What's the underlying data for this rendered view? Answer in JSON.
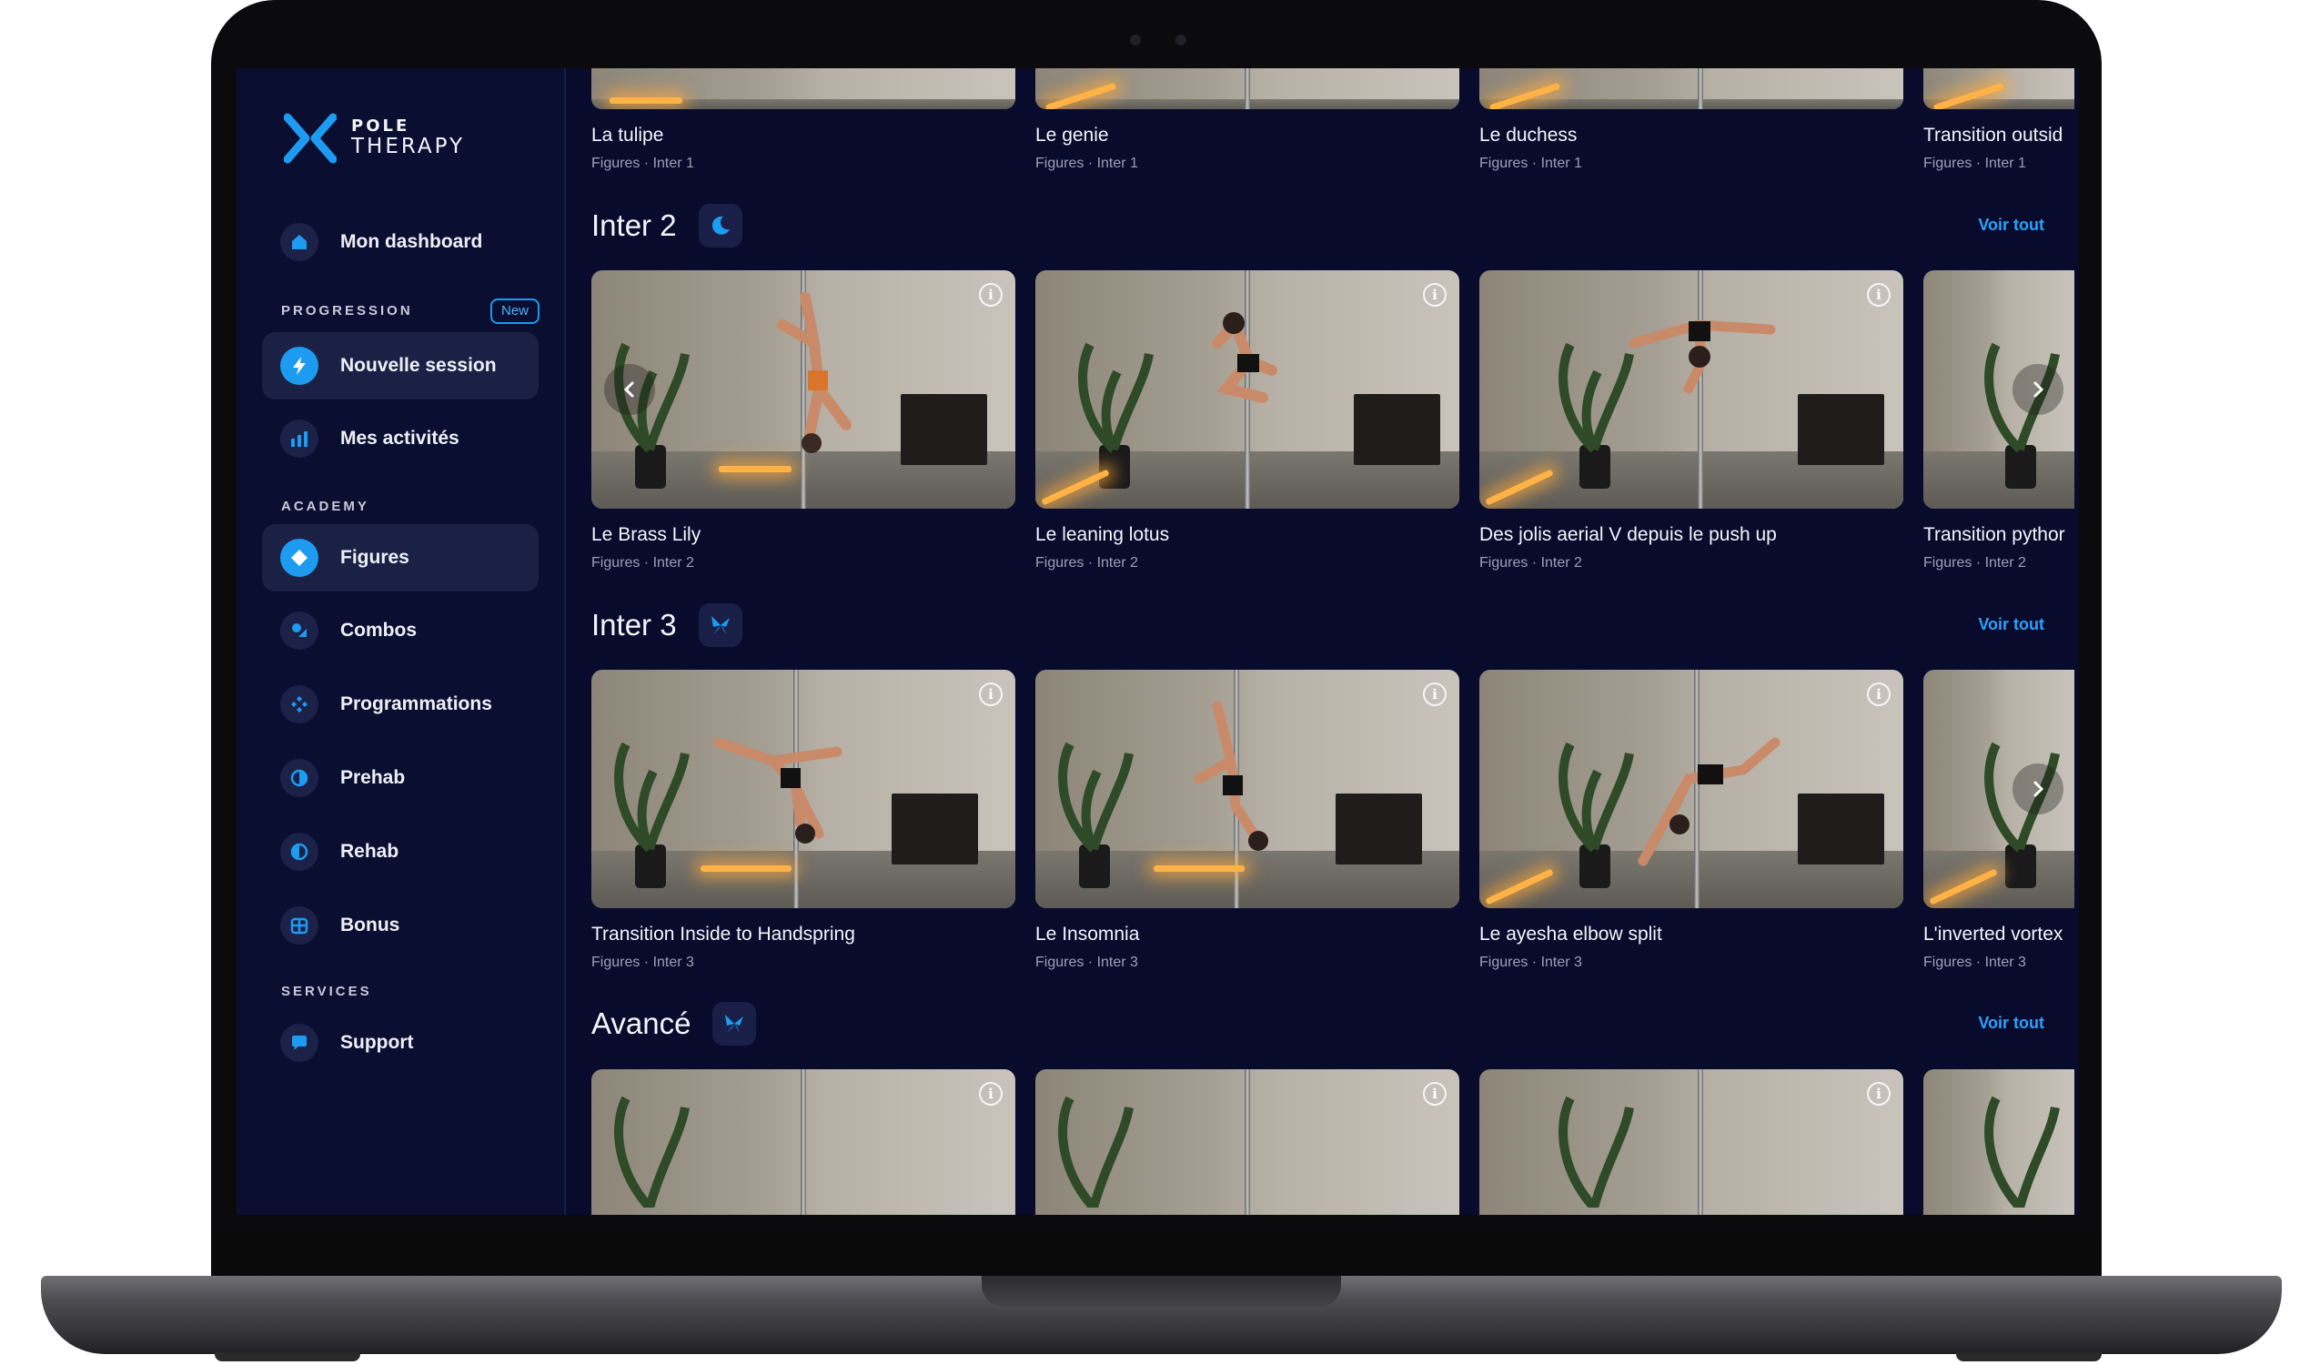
{
  "brand": {
    "line1": "POLE",
    "line2": "THERAPY"
  },
  "sidebar": {
    "dashboard": "Mon dashboard",
    "progression_label": "PROGRESSION",
    "new_badge": "New",
    "nouvelle_session": "Nouvelle session",
    "mes_activites": "Mes activités",
    "academy_label": "ACADEMY",
    "academy_items": [
      "Figures",
      "Combos",
      "Programmations",
      "Prehab",
      "Rehab",
      "Bonus"
    ],
    "services_label": "SERVICES",
    "support": "Support",
    "active_item": "Figures"
  },
  "top_row": [
    {
      "title": "La tulipe",
      "meta": "Figures · Inter 1"
    },
    {
      "title": "Le genie",
      "meta": "Figures · Inter 1"
    },
    {
      "title": "Le duchess",
      "meta": "Figures · Inter 1"
    },
    {
      "title": "Transition outsid",
      "meta": "Figures · Inter 1"
    }
  ],
  "sections": [
    {
      "title": "Inter 2",
      "voir_tout": "Voir tout",
      "cards": [
        {
          "title": "Le Brass Lily",
          "meta": "Figures · Inter 2"
        },
        {
          "title": "Le leaning lotus",
          "meta": "Figures · Inter 2"
        },
        {
          "title": "Des jolis aerial V depuis le push up",
          "meta": "Figures · Inter 2"
        },
        {
          "title": "Transition pythor",
          "meta": "Figures · Inter 2"
        }
      ]
    },
    {
      "title": "Inter 3",
      "voir_tout": "Voir tout",
      "cards": [
        {
          "title": "Transition Inside to Handspring",
          "meta": "Figures · Inter 3"
        },
        {
          "title": "Le Insomnia",
          "meta": "Figures · Inter 3"
        },
        {
          "title": "Le ayesha elbow split",
          "meta": "Figures · Inter 3"
        },
        {
          "title": "L'inverted vortex",
          "meta": "Figures · Inter 3"
        }
      ]
    },
    {
      "title": "Avancé",
      "voir_tout": "Voir tout",
      "cards": [
        {},
        {},
        {},
        {}
      ]
    }
  ],
  "info_glyph": "i",
  "icons": {
    "dashboard": "home-icon",
    "nouvelle_session": "lightning-icon",
    "mes_activites": "bar-chart-icon",
    "figures": "diamond-icon",
    "combos": "combo-icon",
    "programmations": "grid-icon",
    "prehab": "half-circle-icon",
    "rehab": "half-circle-icon",
    "bonus": "gift-icon",
    "support": "chat-icon",
    "inter2_badge": "moon-figure-icon",
    "inter3_badge": "butterfly-icon",
    "avance_badge": "butterfly-icon"
  },
  "colors": {
    "accent": "#1d9bf0",
    "background": "#080b2c",
    "sidebar": "#0a0e30"
  }
}
